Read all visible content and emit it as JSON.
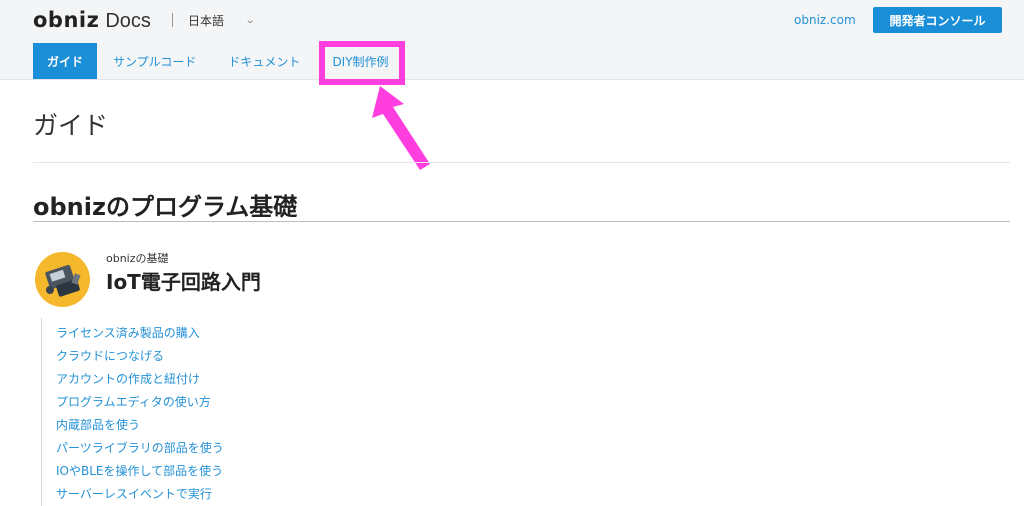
{
  "header": {
    "logo_text": "obniz",
    "logo_docs": "Docs",
    "language": "日本語",
    "top_link": "obniz.com",
    "console_button": "開発者コンソール"
  },
  "tabs": [
    {
      "label": "ガイド",
      "active": true
    },
    {
      "label": "サンプルコード",
      "active": false
    },
    {
      "label": "ドキュメント",
      "active": false
    },
    {
      "label": "DIY制作例",
      "active": false
    }
  ],
  "annotation": {
    "highlight_color": "#ff3ee0"
  },
  "main": {
    "page_title": "ガイド",
    "section_title": "obnizのプログラム基礎",
    "course": {
      "subtitle": "obnizの基礎",
      "title": "IoT電子回路入門",
      "items": [
        "ライセンス済み製品の購入",
        "クラウドにつなげる",
        "アカウントの作成と紐付け",
        "プログラムエディタの使い方",
        "内蔵部品を使う",
        "パーツライブラリの部品を使う",
        "IOやBLEを操作して部品を使う",
        "サーバーレスイベントで実行"
      ]
    }
  },
  "colors": {
    "accent": "#1a8fd8",
    "link": "#2491d6",
    "icon_bg": "#f5b72c"
  }
}
